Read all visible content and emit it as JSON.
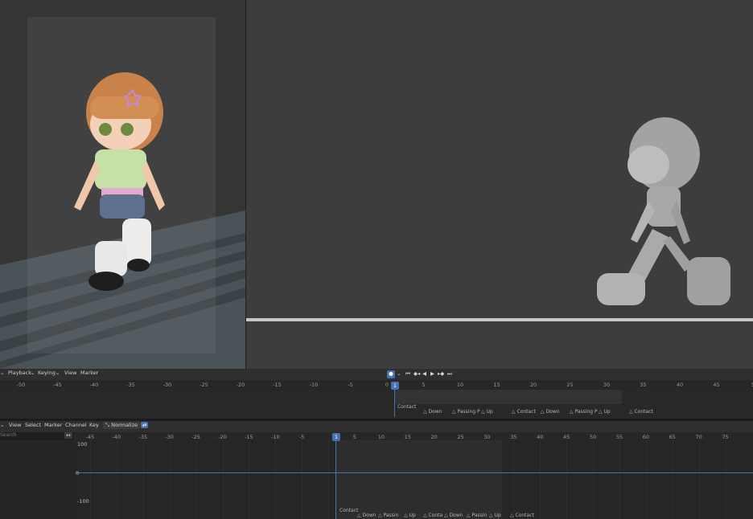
{
  "timeline": {
    "menu": [
      "Playback",
      "Keying",
      "View",
      "Marker"
    ],
    "current_frame": "1",
    "ruler_ticks": [
      "-50",
      "-45",
      "-40",
      "-35",
      "-30",
      "-25",
      "-20",
      "-15",
      "-10",
      "-5",
      "0",
      "5",
      "10",
      "15",
      "20",
      "25",
      "30",
      "35",
      "40",
      "45",
      "5"
    ],
    "markers": [
      "Contact",
      "Down",
      "Passing P",
      "Up",
      "Contact",
      "Down",
      "Passing P",
      "Up",
      "Contact"
    ]
  },
  "graph_editor": {
    "menu": [
      "View",
      "Select",
      "Marker",
      "Channel",
      "Key"
    ],
    "normalize_label": "Normalize",
    "search_placeholder": "Search",
    "current_frame": "1",
    "ruler_ticks": [
      "-45",
      "-40",
      "-35",
      "-30",
      "-25",
      "-20",
      "-15",
      "-10",
      "-5",
      "",
      "5",
      "10",
      "15",
      "20",
      "25",
      "30",
      "35",
      "40",
      "45",
      "50",
      "55",
      "60",
      "65",
      "70",
      "75"
    ],
    "y_labels": [
      "100",
      "0",
      "-100"
    ],
    "markers": [
      "Contact",
      "Down",
      "Passin",
      "Up",
      "Conta",
      "Down",
      "Passin",
      "Up",
      "Contact"
    ]
  },
  "icons": {
    "transport": [
      "jump-start-icon",
      "prev-key-icon",
      "play-reverse-icon",
      "play-icon",
      "next-key-icon",
      "jump-end-icon"
    ]
  },
  "colors": {
    "accent": "#4772b3",
    "viewport": "#3d3d3d",
    "timeline_bg": "#282828"
  }
}
